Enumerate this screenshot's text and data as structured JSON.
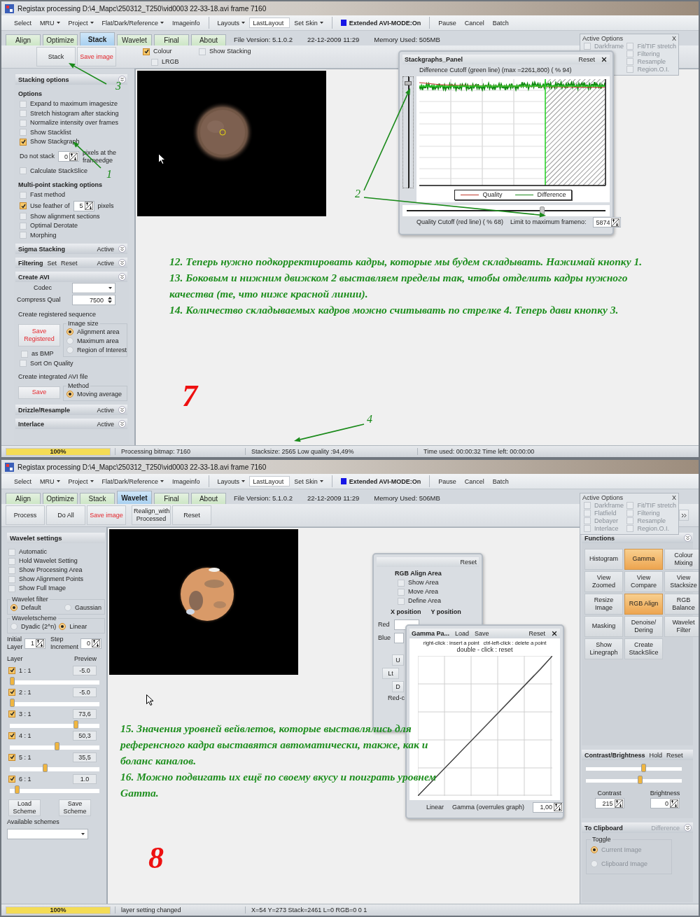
{
  "stack_window": {
    "title": "Registax processing D:\\4_Mapc\\250312_T250\\vid0003 22-33-18.avi frame 7160",
    "menu": [
      {
        "label": "Select",
        "dropdown": false
      },
      {
        "label": "MRU",
        "dropdown": true
      },
      {
        "label": "Project",
        "dropdown": true
      },
      {
        "label": "Flat/Dark/Reference",
        "dropdown": true
      },
      {
        "label": "Imageinfo",
        "dropdown": false
      }
    ],
    "layouts": {
      "label": "Layouts",
      "value": "LastLayout"
    },
    "skin": "Set Skin",
    "avi_mode": {
      "label": "Extended AVI-MODE:On",
      "on": true
    },
    "actions": [
      "Pause",
      "Cancel",
      "Batch"
    ],
    "tabs": [
      {
        "label": "Align",
        "selected": false
      },
      {
        "label": "Optimize",
        "selected": false
      },
      {
        "label": "Stack",
        "selected": true
      },
      {
        "label": "Wavelet",
        "selected": false
      },
      {
        "label": "Final",
        "selected": false
      },
      {
        "label": "About",
        "selected": false
      }
    ],
    "info": [
      "File Version: 5.1.0.2",
      "22-12-2009 11:29",
      "Memory Used: 505MB"
    ],
    "active_options": {
      "title": "Active Options",
      "close": "X",
      "columns": [
        [
          {
            "label": "Darkframe",
            "checked": false
          }
        ],
        [
          {
            "label": "Fit/TIF stretch",
            "checked": false
          },
          {
            "label": "Filtering",
            "checked": false
          },
          {
            "label": "Resample",
            "checked": false
          },
          {
            "label": "Region.O.I.",
            "checked": false
          }
        ]
      ]
    },
    "toolbar": {
      "buttons": [
        {
          "label": "Stack",
          "kind": "normal"
        },
        {
          "label": "Save image",
          "kind": "save"
        }
      ],
      "checks": [
        {
          "label": "Colour",
          "checked": true
        },
        {
          "label": "Show Stacking",
          "checked": false
        },
        {
          "label": "LRGB",
          "checked": false
        }
      ]
    },
    "left_panel": [
      {
        "kind": "section",
        "title": "Stacking options"
      },
      {
        "kind": "heading",
        "label": "Options"
      },
      {
        "kind": "check",
        "label": "Expand to maximum imagesize",
        "checked": false
      },
      {
        "kind": "check",
        "label": "Stretch histogram after stacking",
        "checked": false
      },
      {
        "kind": "check",
        "label": "Normalize intensity over frames",
        "checked": false
      },
      {
        "kind": "check",
        "label": "Show Stacklist",
        "checked": false
      },
      {
        "kind": "check",
        "label": "Show Stackgraph",
        "checked": true
      },
      {
        "kind": "spin",
        "label": "Do not stack",
        "value": "0",
        "suffix": "pixels at the frameedge"
      },
      {
        "kind": "check",
        "label": "Calculate StackSlice",
        "checked": false
      },
      {
        "kind": "heading",
        "label": "Multi-point stacking options"
      },
      {
        "kind": "check",
        "label": "Fast method",
        "checked": false
      },
      {
        "kind": "check-spin",
        "label": "Use feather of",
        "checked": true,
        "value": "5",
        "suffix": "pixels"
      },
      {
        "kind": "check",
        "label": "Show alignment sections",
        "checked": false
      },
      {
        "kind": "check",
        "label": "Optimal Derotate",
        "checked": false
      },
      {
        "kind": "check",
        "label": "Morphing",
        "checked": false
      },
      {
        "kind": "section",
        "title": "Sigma Stacking",
        "status": "Active"
      },
      {
        "kind": "section",
        "title": "Filtering",
        "extras": [
          "Set",
          "Reset"
        ],
        "status": "Active"
      },
      {
        "kind": "section",
        "title": "Create AVI"
      },
      {
        "kind": "select",
        "label": "Codec"
      },
      {
        "kind": "field",
        "label": "Compress Qual",
        "value": "7500"
      },
      {
        "kind": "text",
        "label": "Create registered sequence"
      },
      {
        "kind": "save-group",
        "button": "Save Registered",
        "check": {
          "label": "as BMP",
          "checked": false
        },
        "group": "Image size",
        "options": [
          {
            "label": "Alignment area",
            "selected": true
          },
          {
            "label": "Maximum area",
            "selected": false
          },
          {
            "label": "Region of Interest",
            "selected": false
          }
        ]
      },
      {
        "kind": "check",
        "label": "Sort On Quality",
        "checked": false
      },
      {
        "kind": "text",
        "label": "Create integrated AVI file"
      },
      {
        "kind": "save-group",
        "button": "Save",
        "group": "Method",
        "options": [
          {
            "label": "Moving average",
            "selected": true
          }
        ]
      },
      {
        "kind": "section",
        "title": "Drizzle/Resample",
        "status": "Active"
      },
      {
        "kind": "section",
        "title": "Interlace",
        "status": "Active"
      }
    ],
    "stackgraph": {
      "title": "Stackgraphs_Panel",
      "reset": "Reset",
      "difference_label": "Difference Cutoff (green line) (max =2261,800) ( % 94)",
      "difference_slider": {
        "level": 0.94
      },
      "legend": [
        {
          "label": "Quality",
          "color": "#c0392b"
        },
        {
          "label": "Difference",
          "color": "#1e8a1e"
        }
      ],
      "quality_slider": {
        "level": 0.68
      },
      "quality_label": "Quality Cutoff (red line) ( % 68)",
      "limit_label": "Limit to maximum frameno:",
      "limit_value": "5874"
    },
    "annotations": {
      "steps": [
        "12. Теперь нужно подкорректировать кадры, которые мы будем складывать. Нажимай кнопку 1.",
        "13. Боковым  и нижним движком 2 выставляем пределы так, чтобы отделить кадры нужного качества (те, что ниже красной линии).",
        "14. Количество складываемых кадров можно считывать по стрелке 4. Теперь дави  кнопку 3."
      ],
      "page_number": "7",
      "markers": [
        "3",
        "1",
        "2",
        "4"
      ]
    },
    "status": {
      "progress": {
        "label": "100%",
        "level": 1
      },
      "cells": [
        "Processing bitmap: 7160",
        "Stacksize: 2565 Low quality :94,49%",
        "Time used: 00:00:32 Time left: 00:00:00"
      ]
    }
  },
  "wavelet_window": {
    "title": "Registax processing D:\\4_Mapc\\250312_T250\\vid0003 22-33-18.avi frame 7160",
    "menu": [
      {
        "label": "Select",
        "dropdown": false
      },
      {
        "label": "MRU",
        "dropdown": true
      },
      {
        "label": "Project",
        "dropdown": true
      },
      {
        "label": "Flat/Dark/Reference",
        "dropdown": true
      },
      {
        "label": "Imageinfo",
        "dropdown": false
      }
    ],
    "layouts": {
      "label": "Layouts",
      "value": "LastLayout"
    },
    "skin": "Set Skin",
    "avi_mode": {
      "label": "Extended AVI-MODE:On",
      "on": true
    },
    "actions": [
      "Pause",
      "Cancel",
      "Batch"
    ],
    "tabs": [
      {
        "label": "Align",
        "selected": false
      },
      {
        "label": "Optimize",
        "selected": false
      },
      {
        "label": "Stack",
        "selected": false
      },
      {
        "label": "Wavelet",
        "selected": true
      },
      {
        "label": "Final",
        "selected": false
      },
      {
        "label": "About",
        "selected": false
      }
    ],
    "info": [
      "File Version: 5.1.0.2",
      "22-12-2009 11:29",
      "Memory Used: 506MB"
    ],
    "active_options": {
      "title": "Active Options",
      "close": "X",
      "columns": [
        [
          {
            "label": "Darkframe",
            "checked": false
          },
          {
            "label": "Flatfield",
            "checked": false
          },
          {
            "label": "Debayer",
            "checked": false
          },
          {
            "label": "Interlace",
            "checked": false
          }
        ],
        [
          {
            "label": "Fit/TIF stretch",
            "checked": false
          },
          {
            "label": "Filtering",
            "checked": false
          },
          {
            "label": "Resample",
            "checked": false
          },
          {
            "label": "Region.O.I.",
            "checked": false
          }
        ]
      ]
    },
    "toolbar": {
      "buttons": [
        {
          "label": "Process",
          "kind": "normal"
        },
        {
          "label": "Do All",
          "kind": "normal"
        },
        {
          "label": "Save image",
          "kind": "save"
        },
        {
          "label": "Realign_with Processed",
          "kind": "normal"
        },
        {
          "label": "Reset",
          "kind": "normal"
        }
      ]
    },
    "wavelet_panel": {
      "title": "Wavelet settings",
      "options": [
        {
          "label": "Automatic",
          "checked": false
        },
        {
          "label": "Hold Wavelet Setting",
          "checked": false
        },
        {
          "label": "Show Processing Area",
          "checked": false
        },
        {
          "label": "Show Alignment Points",
          "checked": false
        },
        {
          "label": "Show Full Image",
          "checked": false
        }
      ],
      "filter": {
        "title": "Wavelet filter",
        "options": [
          {
            "label": "Default",
            "selected": true
          },
          {
            "label": "Gaussian",
            "selected": false
          }
        ]
      },
      "scheme": {
        "title": "Waveletscheme",
        "options": [
          {
            "label": "Dyadic (2^n)",
            "selected": false
          },
          {
            "label": "Linear",
            "selected": true
          }
        ]
      },
      "initial": {
        "label": "Initial Layer",
        "value": "1"
      },
      "step": {
        "label": "Step Increment",
        "value": "0"
      },
      "layer_heading": "Layer",
      "preview_heading": "Preview",
      "layers": [
        {
          "label": "1 : 1",
          "checked": true,
          "value": "-5.0",
          "level": 0.0
        },
        {
          "label": "2 : 1",
          "checked": true,
          "value": "-5.0",
          "level": 0.0
        },
        {
          "label": "3 : 1",
          "checked": true,
          "value": "73,6",
          "level": 0.74
        },
        {
          "label": "4 : 1",
          "checked": true,
          "value": "50,3",
          "level": 0.52
        },
        {
          "label": "5 : 1",
          "checked": true,
          "value": "35,5",
          "level": 0.38
        },
        {
          "label": "6 : 1",
          "checked": true,
          "value": "1.0",
          "level": 0.06
        }
      ],
      "load": "Load Scheme",
      "save": "Save Scheme",
      "schemes_label": "Available schemes"
    },
    "rgb_align": {
      "reset": "Reset",
      "title": "RGB Align Area",
      "checks": [
        {
          "label": "Show Area",
          "checked": false
        },
        {
          "label": "Move Area",
          "checked": false
        },
        {
          "label": "Define Area",
          "checked": false
        }
      ],
      "x_label": "X position",
      "y_label": "Y position",
      "rows": [
        "Red",
        "Blue"
      ],
      "buttons": [
        "U",
        "Lt",
        "D"
      ],
      "note": "Red-c"
    },
    "gamma": {
      "title": "Gamma Pa...",
      "load": "Load",
      "save": "Save",
      "reset": "Reset",
      "hint": "right-click : insert a point   ctrl-left-click : delete a point",
      "hint2": "double - click : reset",
      "linear": "Linear",
      "gamma_label": "Gamma (overrules graph)",
      "gamma_value": "1,00"
    },
    "functions": {
      "title": "Functions",
      "buttons": [
        {
          "label": "Histogram",
          "selected": false
        },
        {
          "label": "Gamma",
          "selected": true
        },
        {
          "label": "Colour Mixing",
          "selected": false
        },
        {
          "label": "View Zoomed",
          "selected": false
        },
        {
          "label": "View Compare",
          "selected": false
        },
        {
          "label": "View Stacksize",
          "selected": false
        },
        {
          "label": "Resize Image",
          "selected": false
        },
        {
          "label": "RGB Align",
          "selected": true
        },
        {
          "label": "RGB Balance",
          "selected": false
        },
        {
          "label": "Masking",
          "selected": false
        },
        {
          "label": "Denoise/ Dering",
          "selected": false
        },
        {
          "label": "Wavelet Filter",
          "selected": false
        },
        {
          "label": "Show Linegraph",
          "selected": false
        },
        {
          "label": "Create StackSlice",
          "selected": false
        }
      ]
    },
    "contrast": {
      "title": "Contrast/Brightness",
      "extras": [
        "Hold",
        "Reset"
      ],
      "sliders": [
        {
          "level": 0.6
        },
        {
          "level": 0.56
        }
      ],
      "fields": [
        {
          "label": "Contrast",
          "value": "215"
        },
        {
          "label": "Brightness",
          "value": "0"
        }
      ]
    },
    "clipboard": {
      "title": "To Clipboard",
      "status": "Difference",
      "group": "Toggle",
      "options": [
        {
          "label": "Current Image",
          "selected": true
        },
        {
          "label": "Clipboard Image",
          "selected": false
        }
      ]
    },
    "annotations": {
      "steps": [
        "15. Значения уровней вейвлетов, которые выставлялись для референсного кадра выставятся автоматически, также, как и боланс каналов.",
        "16. Можно подвигать их ещё по своему вкусу и поиграть уровнем Gamma."
      ],
      "page_number": "8"
    },
    "status": {
      "progress": {
        "label": "100%",
        "level": 1
      },
      "cells": [
        "layer setting changed",
        "X=54 Y=273 Stack=2461 L=0 RGB=0 0 1"
      ]
    }
  }
}
